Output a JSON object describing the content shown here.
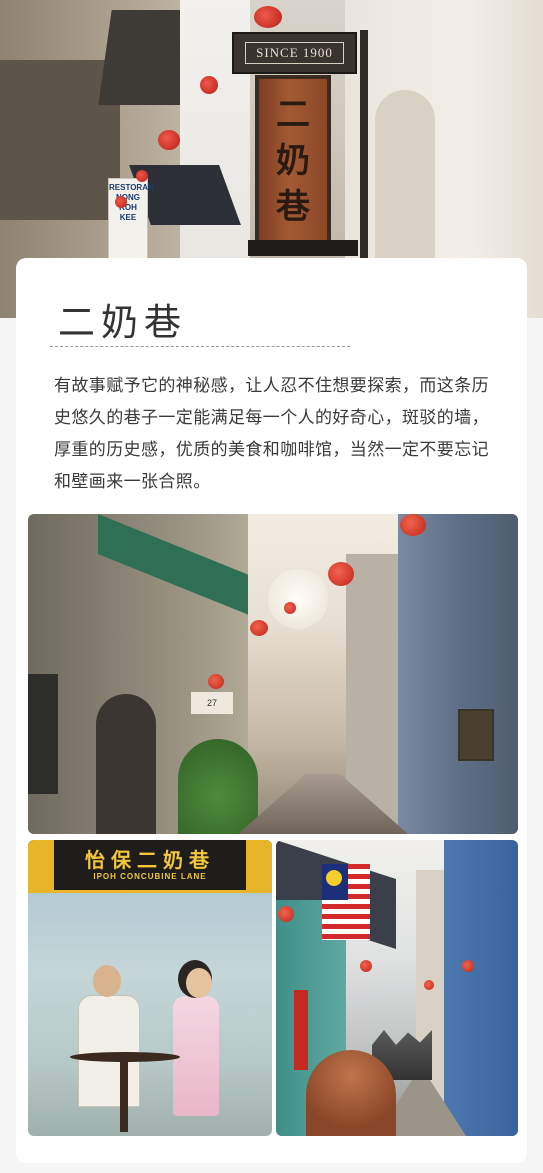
{
  "hero": {
    "since_sign": "SINCE 1900",
    "wood_sign_chars": [
      "二",
      "奶",
      "巷"
    ],
    "restaurant_sign": [
      "RESTORAN",
      "NONG",
      "KOH",
      "KEE"
    ]
  },
  "article": {
    "title": "二奶巷",
    "body": "有故事赋予它的神秘感，让人忍不住想要探索，而这条历史悠久的巷子一定能满足每一个人的好奇心，斑驳的墙，厚重的历史感，优质的美食和咖啡馆，当然一定不要忘记和壁画来一张合照。"
  },
  "photos": {
    "alley": {
      "door_sign": "27"
    },
    "mural": {
      "banner_zh": "怡保二奶巷",
      "banner_en": "IPOH CONCUBINE LANE"
    }
  },
  "colors": {
    "page_bg": "#f4f5f4",
    "card_bg": "#ffffff",
    "title": "#333333",
    "body_text": "#3a3a3a",
    "lantern_red": "#c8281c"
  }
}
